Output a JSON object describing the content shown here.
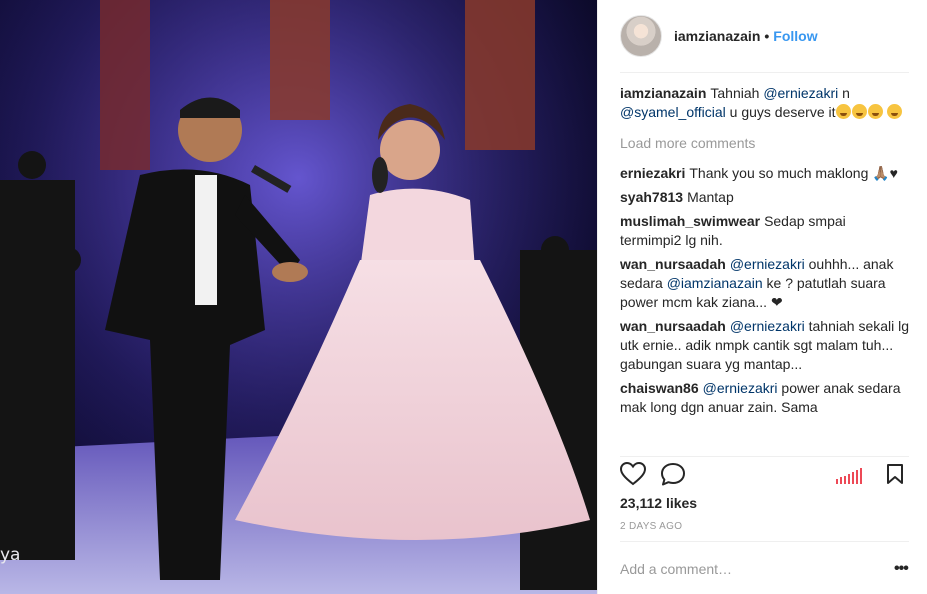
{
  "photo": {
    "caption_text": "ya"
  },
  "header": {
    "username": "iamzianazain",
    "separator": "•",
    "follow_label": "Follow"
  },
  "comments": {
    "caption": {
      "username": "iamzianazain",
      "text_before": "Tahniah ",
      "mention1": "@erniezakri",
      "text_mid": " n ",
      "mention2": "@syamel_official",
      "text_after": " u guys deserve it"
    },
    "load_more": "Load more comments",
    "items": [
      {
        "username": "erniezakri",
        "text": "Thank you so much maklong 🙏🏽♥"
      },
      {
        "username": "syah7813",
        "text": "Mantap"
      },
      {
        "username": "muslimah_swimwear",
        "text": "Sedap smpai termimpi2 lg nih."
      },
      {
        "username": "wan_nursaadah",
        "mention": "@erniezakri",
        "text": " ouhhh... anak sedara ",
        "mention2": "@iamzianazain",
        "text2": " ke ? patutlah suara power mcm kak ziana... ❤"
      },
      {
        "username": "wan_nursaadah",
        "mention": "@erniezakri",
        "text": " tahniah sekali lg utk ernie.. adik nmpk cantik sgt malam tuh... gabungan suara yg mantap..."
      },
      {
        "username": "chaiswan86",
        "mention": "@erniezakri",
        "text": " power anak sedara mak long dgn anuar zain. Sama"
      }
    ]
  },
  "actions": {
    "icons": [
      "heart-icon",
      "comment-icon",
      "bookmark-icon"
    ]
  },
  "likes": "23,112 likes",
  "time": "2 DAYS AGO",
  "add_comment_placeholder": "Add a comment…",
  "more_label": "•••",
  "colors": {
    "link": "#3897f0",
    "mention": "#003569",
    "muted": "#999999",
    "text": "#262626",
    "border": "#efefef"
  }
}
